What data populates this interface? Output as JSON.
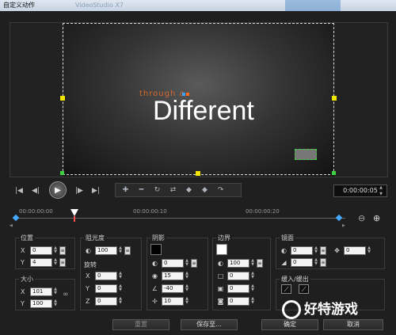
{
  "window": {
    "title": "自定义动作",
    "ghost_title": "VideoStudio X7"
  },
  "preview": {
    "overlay_small_text": "through a",
    "overlay_big_text": "Different"
  },
  "transport": {
    "buttons": [
      "start",
      "prev-frame",
      "play",
      "next-frame",
      "end"
    ],
    "timecode": "0:00:00:05"
  },
  "ruler": {
    "ticks": [
      "00:00:00:00",
      "00:00:00:10",
      "00:00:00:20"
    ]
  },
  "position": {
    "title": "位置",
    "x_label": "X",
    "x": "0",
    "y_label": "Y",
    "y": "4"
  },
  "size": {
    "title": "大小",
    "x_label": "X",
    "x": "101",
    "y_label": "Y",
    "y": "100"
  },
  "opacity": {
    "title": "阻光度",
    "value": "100"
  },
  "rotation": {
    "title": "旋转",
    "x_label": "X",
    "x": "0",
    "y_label": "Y",
    "y": "0",
    "z_label": "Z",
    "z": "0"
  },
  "shadow": {
    "title": "阴影",
    "opacity": "0",
    "blur": "15",
    "angle": "-40",
    "distance": "10",
    "color": "#000000"
  },
  "border": {
    "title": "边界",
    "opacity": "100",
    "w1": "0",
    "w2": "0",
    "w3": "0",
    "color": "#ffffff"
  },
  "mirror": {
    "title": "镜面",
    "v1": "0",
    "v2": "0",
    "v3": "0"
  },
  "fade": {
    "title": "缓入/缓出"
  },
  "buttons": {
    "reset": "重置",
    "save_to": "保存至...",
    "ok": "确定",
    "cancel": "取消"
  },
  "watermark": {
    "text": "好特游戏"
  }
}
